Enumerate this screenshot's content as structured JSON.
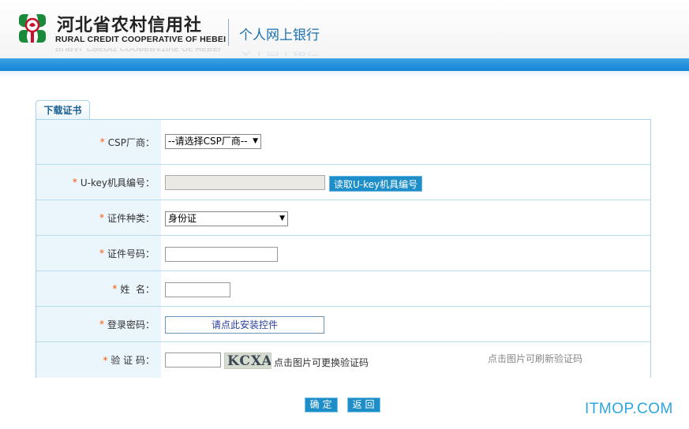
{
  "header": {
    "bank_name_cn": "河北省农村信用社",
    "bank_name_en": "RURAL CREDIT COOPERATIVE OF HEBEI",
    "subtitle": "个人网上银行"
  },
  "tab": {
    "label": "下载证书"
  },
  "form": {
    "required_mark": "*",
    "csp": {
      "label": "CSP厂商：",
      "selected": "--请选择CSP厂商--"
    },
    "ukey": {
      "label": "U-key机具编号：",
      "value": "",
      "read_button": "读取U-key机具编号"
    },
    "cert_type": {
      "label": "证件种类：",
      "selected": "身份证"
    },
    "cert_no": {
      "label": "证件号码：",
      "value": ""
    },
    "name": {
      "label": "姓  名：",
      "value": ""
    },
    "password": {
      "label": "登录密码：",
      "control_text": "请点此安装控件"
    },
    "captcha": {
      "label": "验 证 码：",
      "value": "",
      "image_text": "KCXA",
      "refresh_hint": "点击图片可更换验证码",
      "note": "点击图片可刷新验证码"
    }
  },
  "buttons": {
    "confirm": "确定",
    "back": "返回"
  },
  "watermark": "ITMOP.COM",
  "colors": {
    "accent": "#1e8ec9",
    "header_bar": "#1283d6",
    "required": "#ff5500",
    "label_bg": "#eaf5fc",
    "brand_green": "#1a8a3a",
    "brand_red": "#c8102e"
  },
  "icons": {
    "logo": "rural-credit-logo-icon",
    "dropdown": "chevron-down-icon"
  }
}
